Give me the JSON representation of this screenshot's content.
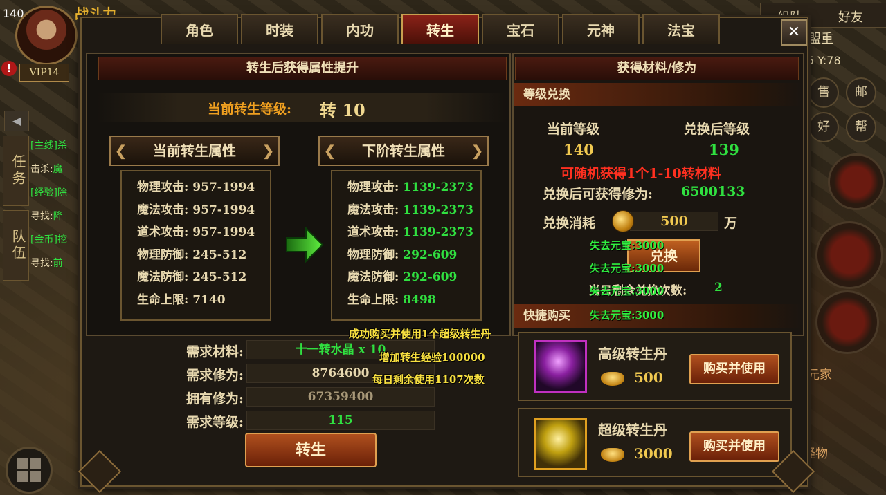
{
  "hud": {
    "level": "140",
    "vip": "VIP14",
    "power_label": "战斗力",
    "left_tabs": [
      "任务",
      "队伍"
    ],
    "quests": [
      {
        "tag": "[主线]",
        "text": "杀",
        "color": "#30e040"
      },
      {
        "tag": "击杀:",
        "text": "魔",
        "color": "#e8d9b0"
      },
      {
        "tag": "[经验]",
        "text": "除",
        "color": "#30e040"
      },
      {
        "tag": "寻找:",
        "text": "降",
        "color": "#e8d9b0"
      },
      {
        "tag": "[金币]",
        "text": "挖",
        "color": "#30e040"
      },
      {
        "tag": "寻找:",
        "text": "前",
        "color": "#e8d9b0"
      }
    ],
    "team_label": "组队",
    "friend_label": "好友",
    "guild": "盟重",
    "coords": "5 Y:78",
    "side_buttons": [
      "售",
      "邮",
      "好",
      "帮"
    ],
    "right_name": "元家",
    "pet_label": "怪物"
  },
  "tabs": [
    {
      "label": "角色",
      "active": false
    },
    {
      "label": "时装",
      "active": false
    },
    {
      "label": "内功",
      "active": false
    },
    {
      "label": "转生",
      "active": true
    },
    {
      "label": "宝石",
      "active": false
    },
    {
      "label": "元神",
      "active": false
    },
    {
      "label": "法宝",
      "active": false
    }
  ],
  "close_label": "✕",
  "left": {
    "header": "转生后获得属性提升",
    "current_level_label": "当前转生等级:",
    "current_level_value": "转 10",
    "current_title": "当前转生属性",
    "next_title": "下阶转生属性",
    "current_attrs": [
      {
        "name": "物理攻击:",
        "value": "957-1994"
      },
      {
        "name": "魔法攻击:",
        "value": "957-1994"
      },
      {
        "name": "道术攻击:",
        "value": "957-1994"
      },
      {
        "name": "物理防御:",
        "value": "245-512"
      },
      {
        "name": "魔法防御:",
        "value": "245-512"
      },
      {
        "name": "生命上限:",
        "value": "7140"
      }
    ],
    "next_attrs": [
      {
        "name": "物理攻击:",
        "value": "1139-2373"
      },
      {
        "name": "魔法攻击:",
        "value": "1139-2373"
      },
      {
        "name": "道术攻击:",
        "value": "1139-2373"
      },
      {
        "name": "物理防御:",
        "value": "292-609"
      },
      {
        "name": "魔法防御:",
        "value": "292-609"
      },
      {
        "name": "生命上限:",
        "value": "8498"
      }
    ],
    "requirements": [
      {
        "label": "需求材料:",
        "value": "十一转水晶 x 10",
        "color": "#30e040"
      },
      {
        "label": "需求修为:",
        "value": "8764600",
        "color": "#e8d9b0"
      },
      {
        "label": "拥有修为:",
        "value": "67359400",
        "color": "#a89878"
      },
      {
        "label": "需求等级:",
        "value": "115",
        "color": "#30e040"
      }
    ],
    "rebirth_button": "转生"
  },
  "right": {
    "header": "获得材料/修为",
    "exchange_section": "等级兑换",
    "current_level_label": "当前等级",
    "after_level_label": "兑换后等级",
    "current_level": "140",
    "after_level": "139",
    "random_text": "可随机获得1个1-10转材料",
    "gain_label": "兑换后可获得修为:",
    "gain_value": "6500133",
    "cost_label": "兑换消耗",
    "cost_value": "500",
    "cost_unit": "万",
    "exchange_button": "兑换",
    "remaining_label": "当日剩余兑换次数:",
    "remaining_value": "2",
    "quick_buy_section": "快捷购买",
    "items": [
      {
        "name": "高级转生丹",
        "price": "500",
        "button": "购买并使用",
        "color": "#c030c0"
      },
      {
        "name": "超级转生丹",
        "price": "3000",
        "button": "购买并使用",
        "color": "#e0a020"
      }
    ]
  },
  "floating": {
    "lost_ingot": "失去元宝:3000",
    "success_msg": "成功购买并使用1个超级转生丹",
    "exp_msg": "增加转生经验100000",
    "daily_msg": "每日剩余使用1107次数"
  }
}
